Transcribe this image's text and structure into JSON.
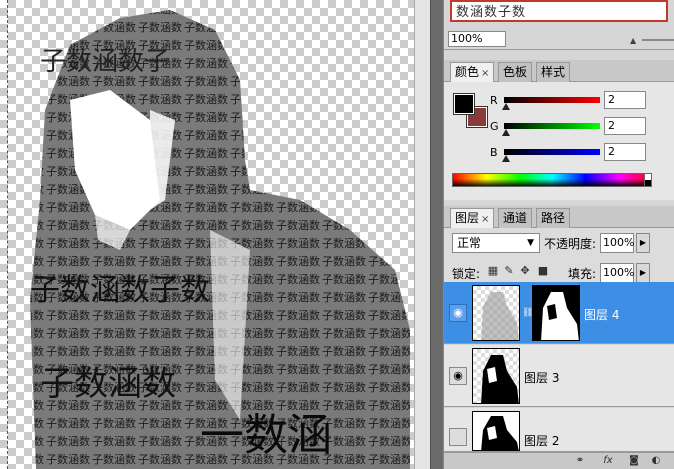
{
  "canvas": {
    "text_fragments": [
      "子数涵数子数涵数子",
      "数涵数子数涵",
      "子数涵数子数涵数",
      "涵数子数涵数子数",
      "子数涵数",
      "一数涵"
    ]
  },
  "navigator": {
    "thumbnail_text": "数涵数子数",
    "zoom_value": "100%"
  },
  "color_panel": {
    "tabs": [
      {
        "label": "颜色",
        "close": "×"
      },
      {
        "label": "色板"
      },
      {
        "label": "样式"
      }
    ],
    "foreground_color": "#000000",
    "background_color": "#8b3a3a",
    "channels": [
      {
        "name": "R",
        "value": "2"
      },
      {
        "name": "G",
        "value": "2"
      },
      {
        "name": "B",
        "value": "2"
      }
    ]
  },
  "layers_panel": {
    "tabs": [
      {
        "label": "图层",
        "close": "×"
      },
      {
        "label": "通道"
      },
      {
        "label": "路径"
      }
    ],
    "blend_mode": "正常",
    "opacity_label": "不透明度:",
    "opacity_value": "100%",
    "lock_label": "锁定:",
    "fill_label": "填充:",
    "fill_value": "100%",
    "layers": [
      {
        "name": "图层 4",
        "selected": true,
        "visible": true
      },
      {
        "name": "图层 3",
        "selected": false,
        "visible": true
      },
      {
        "name": "图层 2",
        "selected": false,
        "visible": false
      }
    ],
    "footer_icons": [
      "link-icon",
      "fx-icon",
      "mask-icon",
      "adjustment-icon"
    ]
  }
}
